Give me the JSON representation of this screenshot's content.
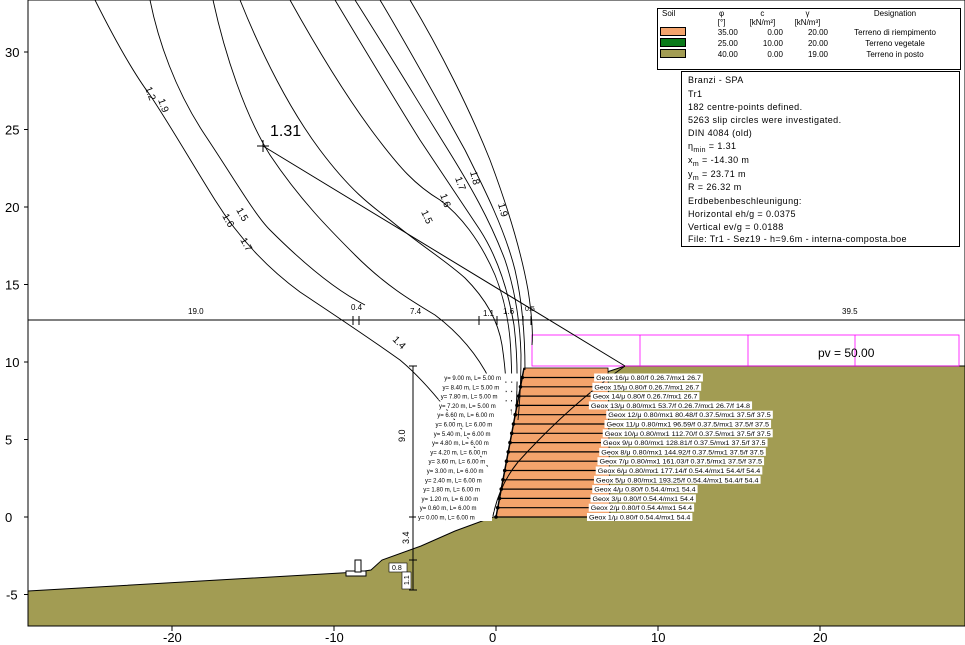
{
  "axes": {
    "x_ticks": [
      -20,
      -10,
      0,
      10,
      20
    ],
    "y_ticks": [
      30,
      25,
      20,
      15,
      10,
      5,
      0,
      -5
    ]
  },
  "legend": {
    "headers": [
      "Soil",
      "φ",
      "c",
      "γ",
      "Designation"
    ],
    "units": [
      "[°]",
      "[kN/m²]",
      "[kN/m³]"
    ],
    "rows": [
      {
        "color": "#f4a46c",
        "phi": "35.00",
        "c": "0.00",
        "gamma": "20.00",
        "name": "Terreno di riempimento"
      },
      {
        "color": "#0a7a1a",
        "phi": "25.00",
        "c": "10.00",
        "gamma": "20.00",
        "name": "Terreno vegetale"
      },
      {
        "color": "#a29c53",
        "phi": "40.00",
        "c": "0.00",
        "gamma": "19.00",
        "name": "Terreno in posto"
      }
    ]
  },
  "info": {
    "project": "Branzi - SPA",
    "section": "Tr1",
    "centres": "182 centre-points defined.",
    "circles": "5263 slip circles were investigated.",
    "code": "DIN 4084 (old)",
    "eta_label": "η",
    "eta_sub": "min",
    "eta_val": " = 1.31",
    "xm_label": "x",
    "xm_sub": "m",
    "xm_val": " = -14.30 m",
    "ym_label": "y",
    "ym_sub": "m",
    "ym_val": " = 23.71 m",
    "radius": "R = 26.32 m",
    "quake": "Erdbebenbeschleunigung:",
    "horizontal": "Horizontal eh/g = 0.0375",
    "vertical": "Vertical ev/g = 0.0188",
    "file": "File: Tr1 - Sez19 - h=9.6m - interna-composta.boe"
  },
  "min_factor": "1.31",
  "surcharge": "pv = 50.00",
  "top_dims": [
    "19.0",
    "0.4",
    "7.4",
    "1.1",
    "1.6",
    "0.5",
    "39.5"
  ],
  "contour_labels": [
    "1.2",
    "1.9",
    "1.5",
    "1.6",
    "1.7",
    "1.4",
    "1.5",
    "1.6",
    "1.7",
    "1.8",
    "1.9"
  ],
  "height_dims": [
    "9.0",
    "3.4",
    "0.8",
    "1.1"
  ],
  "reinforcement": {
    "left_labels": [
      "y= 9.00 m, L= 5.00 m",
      "y= 8.40 m, L= 5.00 m",
      "y= 7.80 m, L= 5.00 m",
      "y= 7.20 m, L= 5.00 m",
      "y= 6.60 m, L= 6.00 m",
      "y= 6.00 m, L= 6.00 m",
      "y= 5.40 m, L= 6.00 m",
      "y= 4.80 m, L= 6.00 m",
      "y= 4.20 m, L= 6.00 m",
      "y= 3.60 m, L= 6.00 m",
      "y= 3.00 m, L= 6.00 m",
      "y= 2.40 m, L= 6.00 m",
      "y= 1.80 m, L= 6.00 m",
      "y= 1.20 m, L= 6.00 m",
      "y= 0.60 m, L= 6.00 m",
      "y= 0.00 m, L= 6.00 m"
    ],
    "right_labels": [
      "Geox 16/μ 0.80/f 0.26.7/mx1 26.7",
      "Geox 15/μ 0.80/f 0.26.7/mx1 26.7",
      "Geox 14/μ 0.80/f 0.26.7/mx1 26.7",
      "Geox 13/μ 0.80/mx1 53.7/f 0.26.7/mx1 26.7/f 14.8",
      "Geox 12/μ 0.80/mx1 80.48/f 0.37.5/mx1 37.5/f 37.5",
      "Geox 11/μ 0.80/mx1 96.59/f 0.37.5/mx1 37.5/f 37.5",
      "Geox 10/μ 0.80/mx1 112.70/f 0.37.5/mx1 37.5/f 37.5",
      "Geox 9/μ 0.80/mx1 128.81/f 0.37.5/mx1 37.5/f 37.5",
      "Geox 8/μ 0.80/mx1 144.92/f 0.37.5/mx1 37.5/f 37.5",
      "Geox 7/μ 0.80/mx1 161.03/f 0.37.5/mx1 37.5/f 37.5",
      "Geox 6/μ 0.80/mx1 177.14/f 0.54.4/mx1 54.4/f 54.4",
      "Geox 5/μ 0.80/mx1 193.25/f 0.54.4/mx1 54.4/f 54.4",
      "Geox 4/μ 0.80/f 0.54.4/mx1 54.4",
      "Geox 3/μ 0.80/f 0.54.4/mx1 54.4",
      "Geox 2/μ 0.80/f 0.54.4/mx1 54.4",
      "Geox 1/μ 0.80/f 0.54.4/mx1 54.4"
    ]
  },
  "colors": {
    "natural": "#a29c53",
    "fill": "#f4a46c",
    "vegetal": "#0a7a1a",
    "surcharge": "#ff00ff"
  }
}
